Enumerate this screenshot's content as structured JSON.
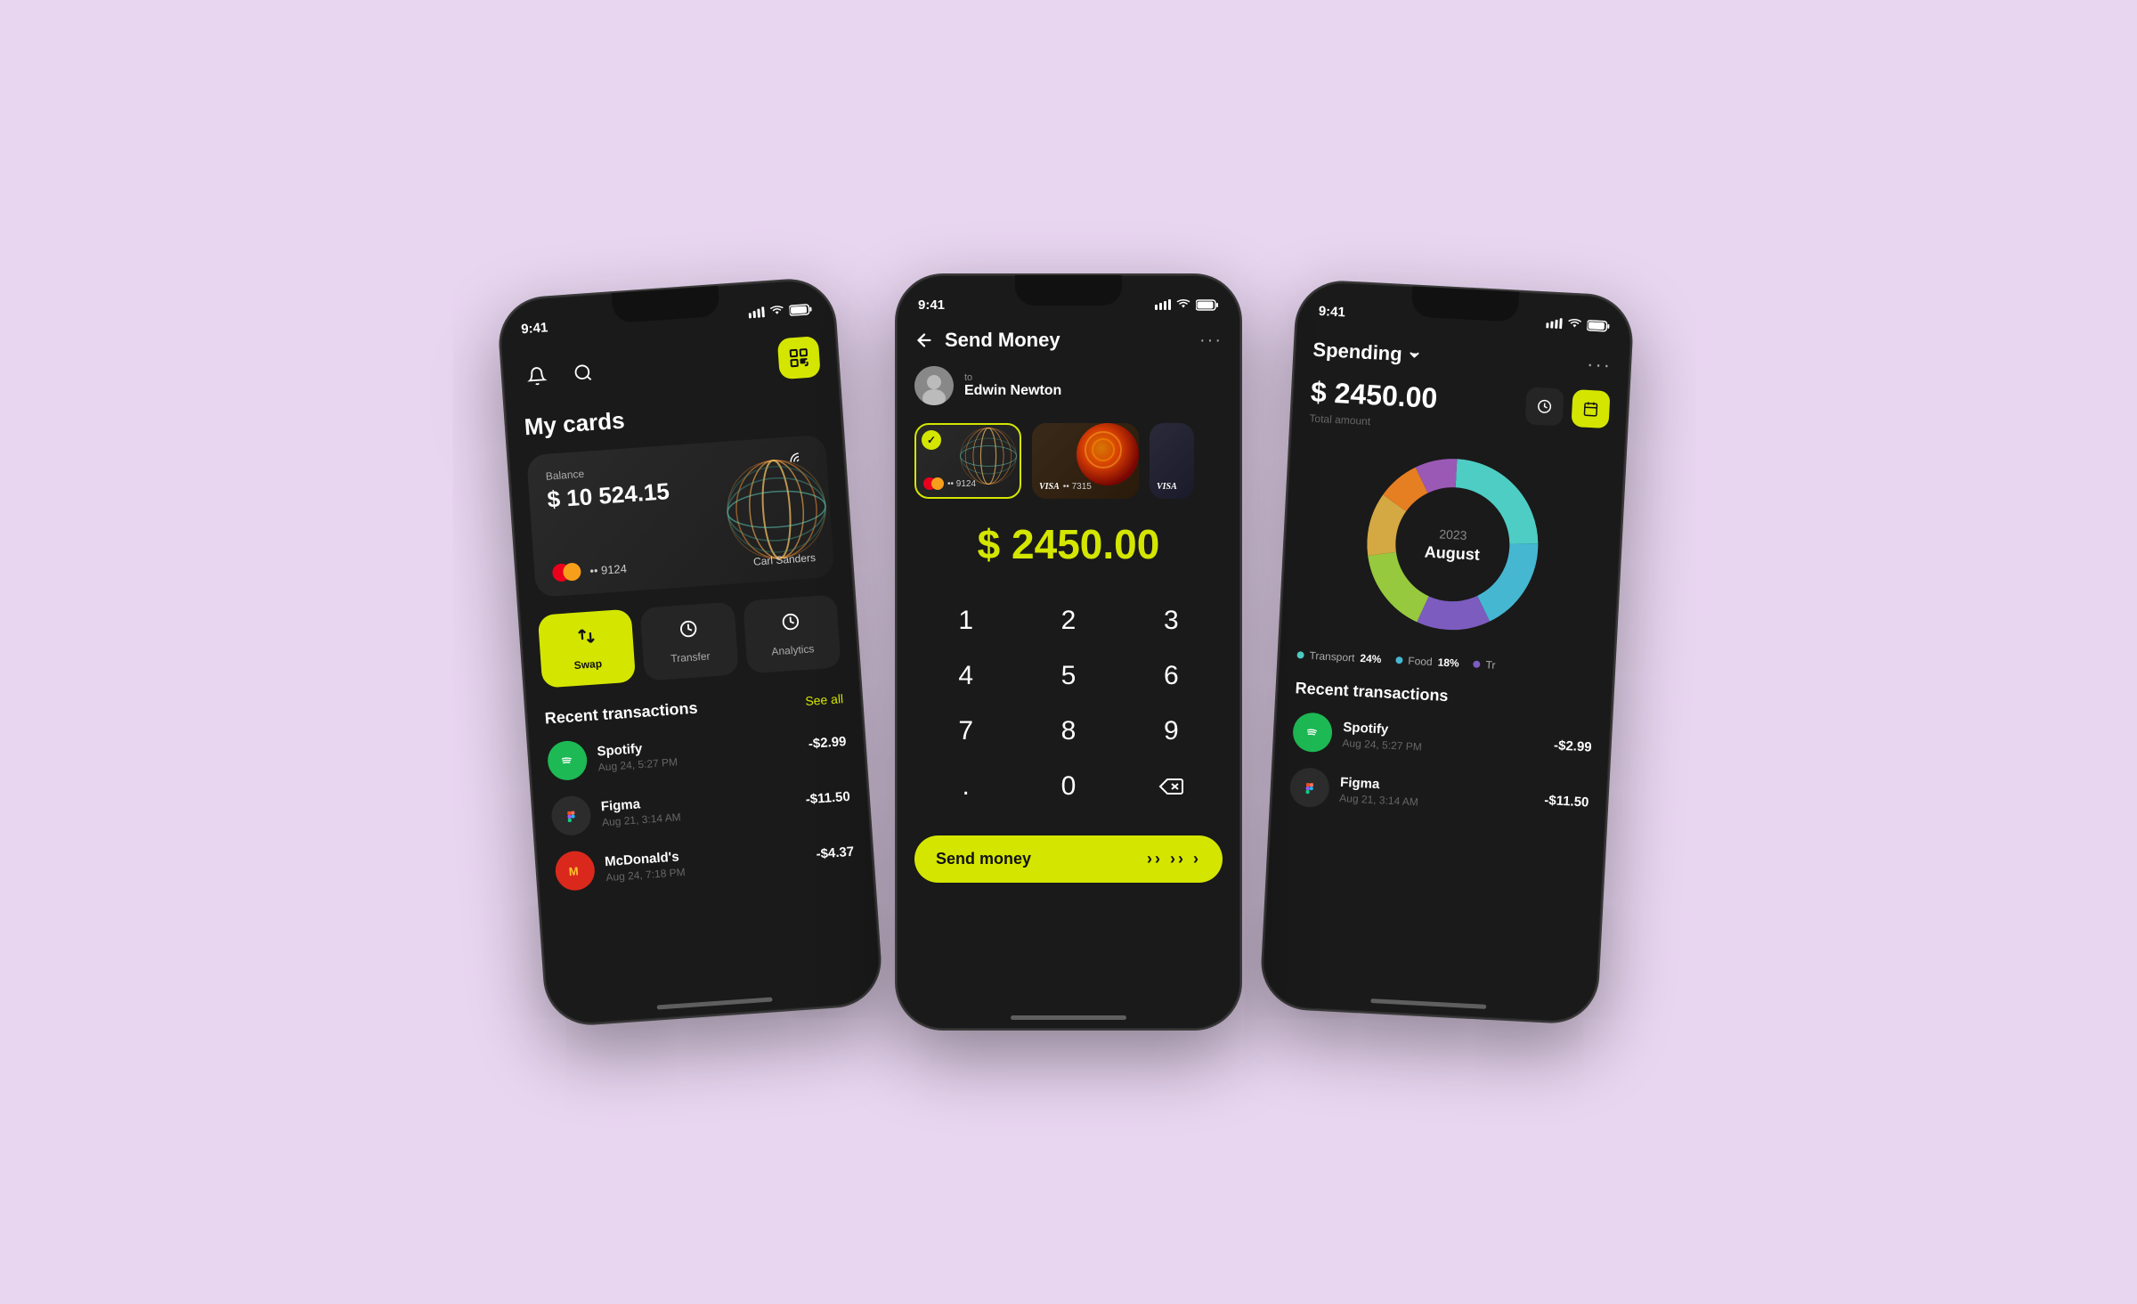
{
  "background": "#e8d5f0",
  "phone1": {
    "status_time": "9:41",
    "title": "My cards",
    "card": {
      "balance_label": "Balance",
      "balance": "$ 10 524.15",
      "number": "•• 9124",
      "holder": "Carl Sanders"
    },
    "actions": [
      {
        "id": "swap",
        "label": "Swap",
        "icon": "⇄",
        "active": true
      },
      {
        "id": "transfer",
        "label": "Transfer",
        "icon": "⟳",
        "active": false
      },
      {
        "id": "analytics",
        "label": "Analytics",
        "icon": "⏱",
        "active": false
      }
    ],
    "transactions_title": "Recent transactions",
    "see_all": "See all",
    "transactions": [
      {
        "name": "Spotify",
        "date": "Aug 24, 5:27 PM",
        "amount": "-$2.99",
        "icon": "♫",
        "color": "#1db954"
      },
      {
        "name": "Figma",
        "date": "Aug 21, 3:14 AM",
        "amount": "-$11.50",
        "icon": "✦",
        "color": "#2c2c2c"
      },
      {
        "name": "McDonald's",
        "date": "Aug 24, 7:18 PM",
        "amount": "-$4.37",
        "icon": "M",
        "color": "#da291c"
      }
    ]
  },
  "phone2": {
    "status_time": "9:41",
    "title": "Send Money",
    "recipient_label": "to",
    "recipient_name": "Edwin Newton",
    "cards": [
      {
        "number": "•• 9124",
        "selected": true
      },
      {
        "number": "•• 7315",
        "selected": false
      }
    ],
    "amount": "$ 2450.00",
    "numpad": [
      "1",
      "2",
      "3",
      "4",
      "5",
      "6",
      "7",
      "8",
      "9",
      ".",
      "0",
      "⌫"
    ],
    "send_btn_label": "Send money",
    "send_arrows": "»»»»"
  },
  "phone3": {
    "status_time": "9:41",
    "title": "Spending",
    "total_amount": "$ 2450.00",
    "total_label": "Total amount",
    "chart": {
      "year": "2023",
      "month": "August",
      "segments": [
        {
          "color": "#4ecdc4",
          "pct": 24,
          "label": "Transport"
        },
        {
          "color": "#45b7d1",
          "pct": 18,
          "label": "Food"
        },
        {
          "color": "#7c5cbf",
          "pct": 14,
          "label": "Tr"
        },
        {
          "color": "#96c93d",
          "pct": 16,
          "label": ""
        },
        {
          "color": "#d4a843",
          "pct": 12,
          "label": ""
        },
        {
          "color": "#e67e22",
          "pct": 8,
          "label": ""
        },
        {
          "color": "#9b59b6",
          "pct": 8,
          "label": ""
        }
      ]
    },
    "legend": [
      {
        "color": "#4ecdc4",
        "label": "Transport",
        "pct": "24%"
      },
      {
        "color": "#45b7d1",
        "label": "Food",
        "pct": "18%"
      },
      {
        "color": "#7c5cbf",
        "label": "Tr",
        "pct": ""
      }
    ],
    "transactions_title": "Recent transactions",
    "transactions": [
      {
        "name": "Spotify",
        "date": "Aug 24, 5:27 PM",
        "amount": "-$2.99",
        "color": "#1db954"
      },
      {
        "name": "Figma",
        "date": "Aug 21, 3:14 AM",
        "amount": "-$11.50",
        "color": "#2c2c2c"
      }
    ]
  }
}
